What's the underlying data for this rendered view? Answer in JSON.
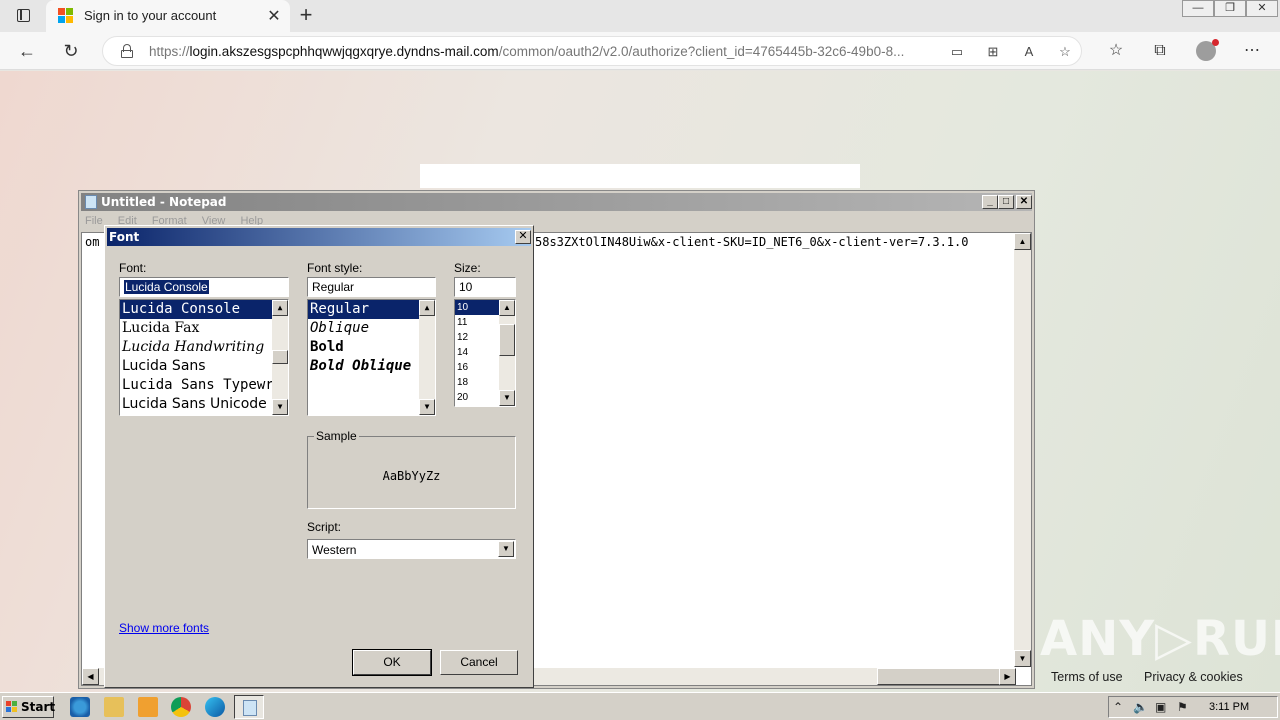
{
  "browser": {
    "tab_title": "Sign in to your account",
    "tab_close": "✕",
    "new_tab": "+",
    "url_prefix": "https://",
    "url_domain": "login.akszesgspcphhqwwjqgxqrye.dyndns-mail.com",
    "url_path": "/common/oauth2/v2.0/authorize?client_id=4765445b-32c6-49b0-8...",
    "back": "←",
    "refresh": "↻",
    "window_controls": [
      "—",
      "❐",
      "✕"
    ]
  },
  "page": {
    "footer_links": [
      "Terms of use",
      "Privacy & cookies",
      "..."
    ],
    "watermark": "ANY▷RUN"
  },
  "notepad": {
    "title": "Untitled - Notepad",
    "menu": [
      "File",
      "Edit",
      "Format",
      "View",
      "Help"
    ],
    "line_left": "om",
    "line_right": "58s3ZXtOlIN48Uiw&x-client-SKU=ID_NET6_0&x-client-ver=7.3.1.0",
    "buttons": [
      "_",
      "□",
      "✕"
    ]
  },
  "font_dialog": {
    "title": "Font",
    "close": "✕",
    "font_label": "Font:",
    "font_value": "Lucida Console",
    "fonts": [
      "Lucida Console",
      "Lucida Fax",
      "Lucida Handwriting",
      "Lucida Sans",
      "Lucida Sans Typewriter",
      "Lucida Sans Unicode"
    ],
    "style_label": "Font style:",
    "style_value": "Regular",
    "styles": [
      "Regular",
      "Oblique",
      "Bold",
      "Bold Oblique"
    ],
    "size_label": "Size:",
    "size_value": "10",
    "sizes": [
      "10",
      "11",
      "12",
      "14",
      "16",
      "18",
      "20"
    ],
    "sample_label": "Sample",
    "sample_text": "AaBbYyZz",
    "script_label": "Script:",
    "script_value": "Western",
    "show_more": "Show more fonts",
    "ok": "OK",
    "cancel": "Cancel"
  },
  "taskbar": {
    "start": "Start",
    "clock": "3:11 PM"
  },
  "colors": {
    "dialog_title": "#0a246a",
    "selection": "#0a246a",
    "classic_face": "#d4d0c8"
  }
}
